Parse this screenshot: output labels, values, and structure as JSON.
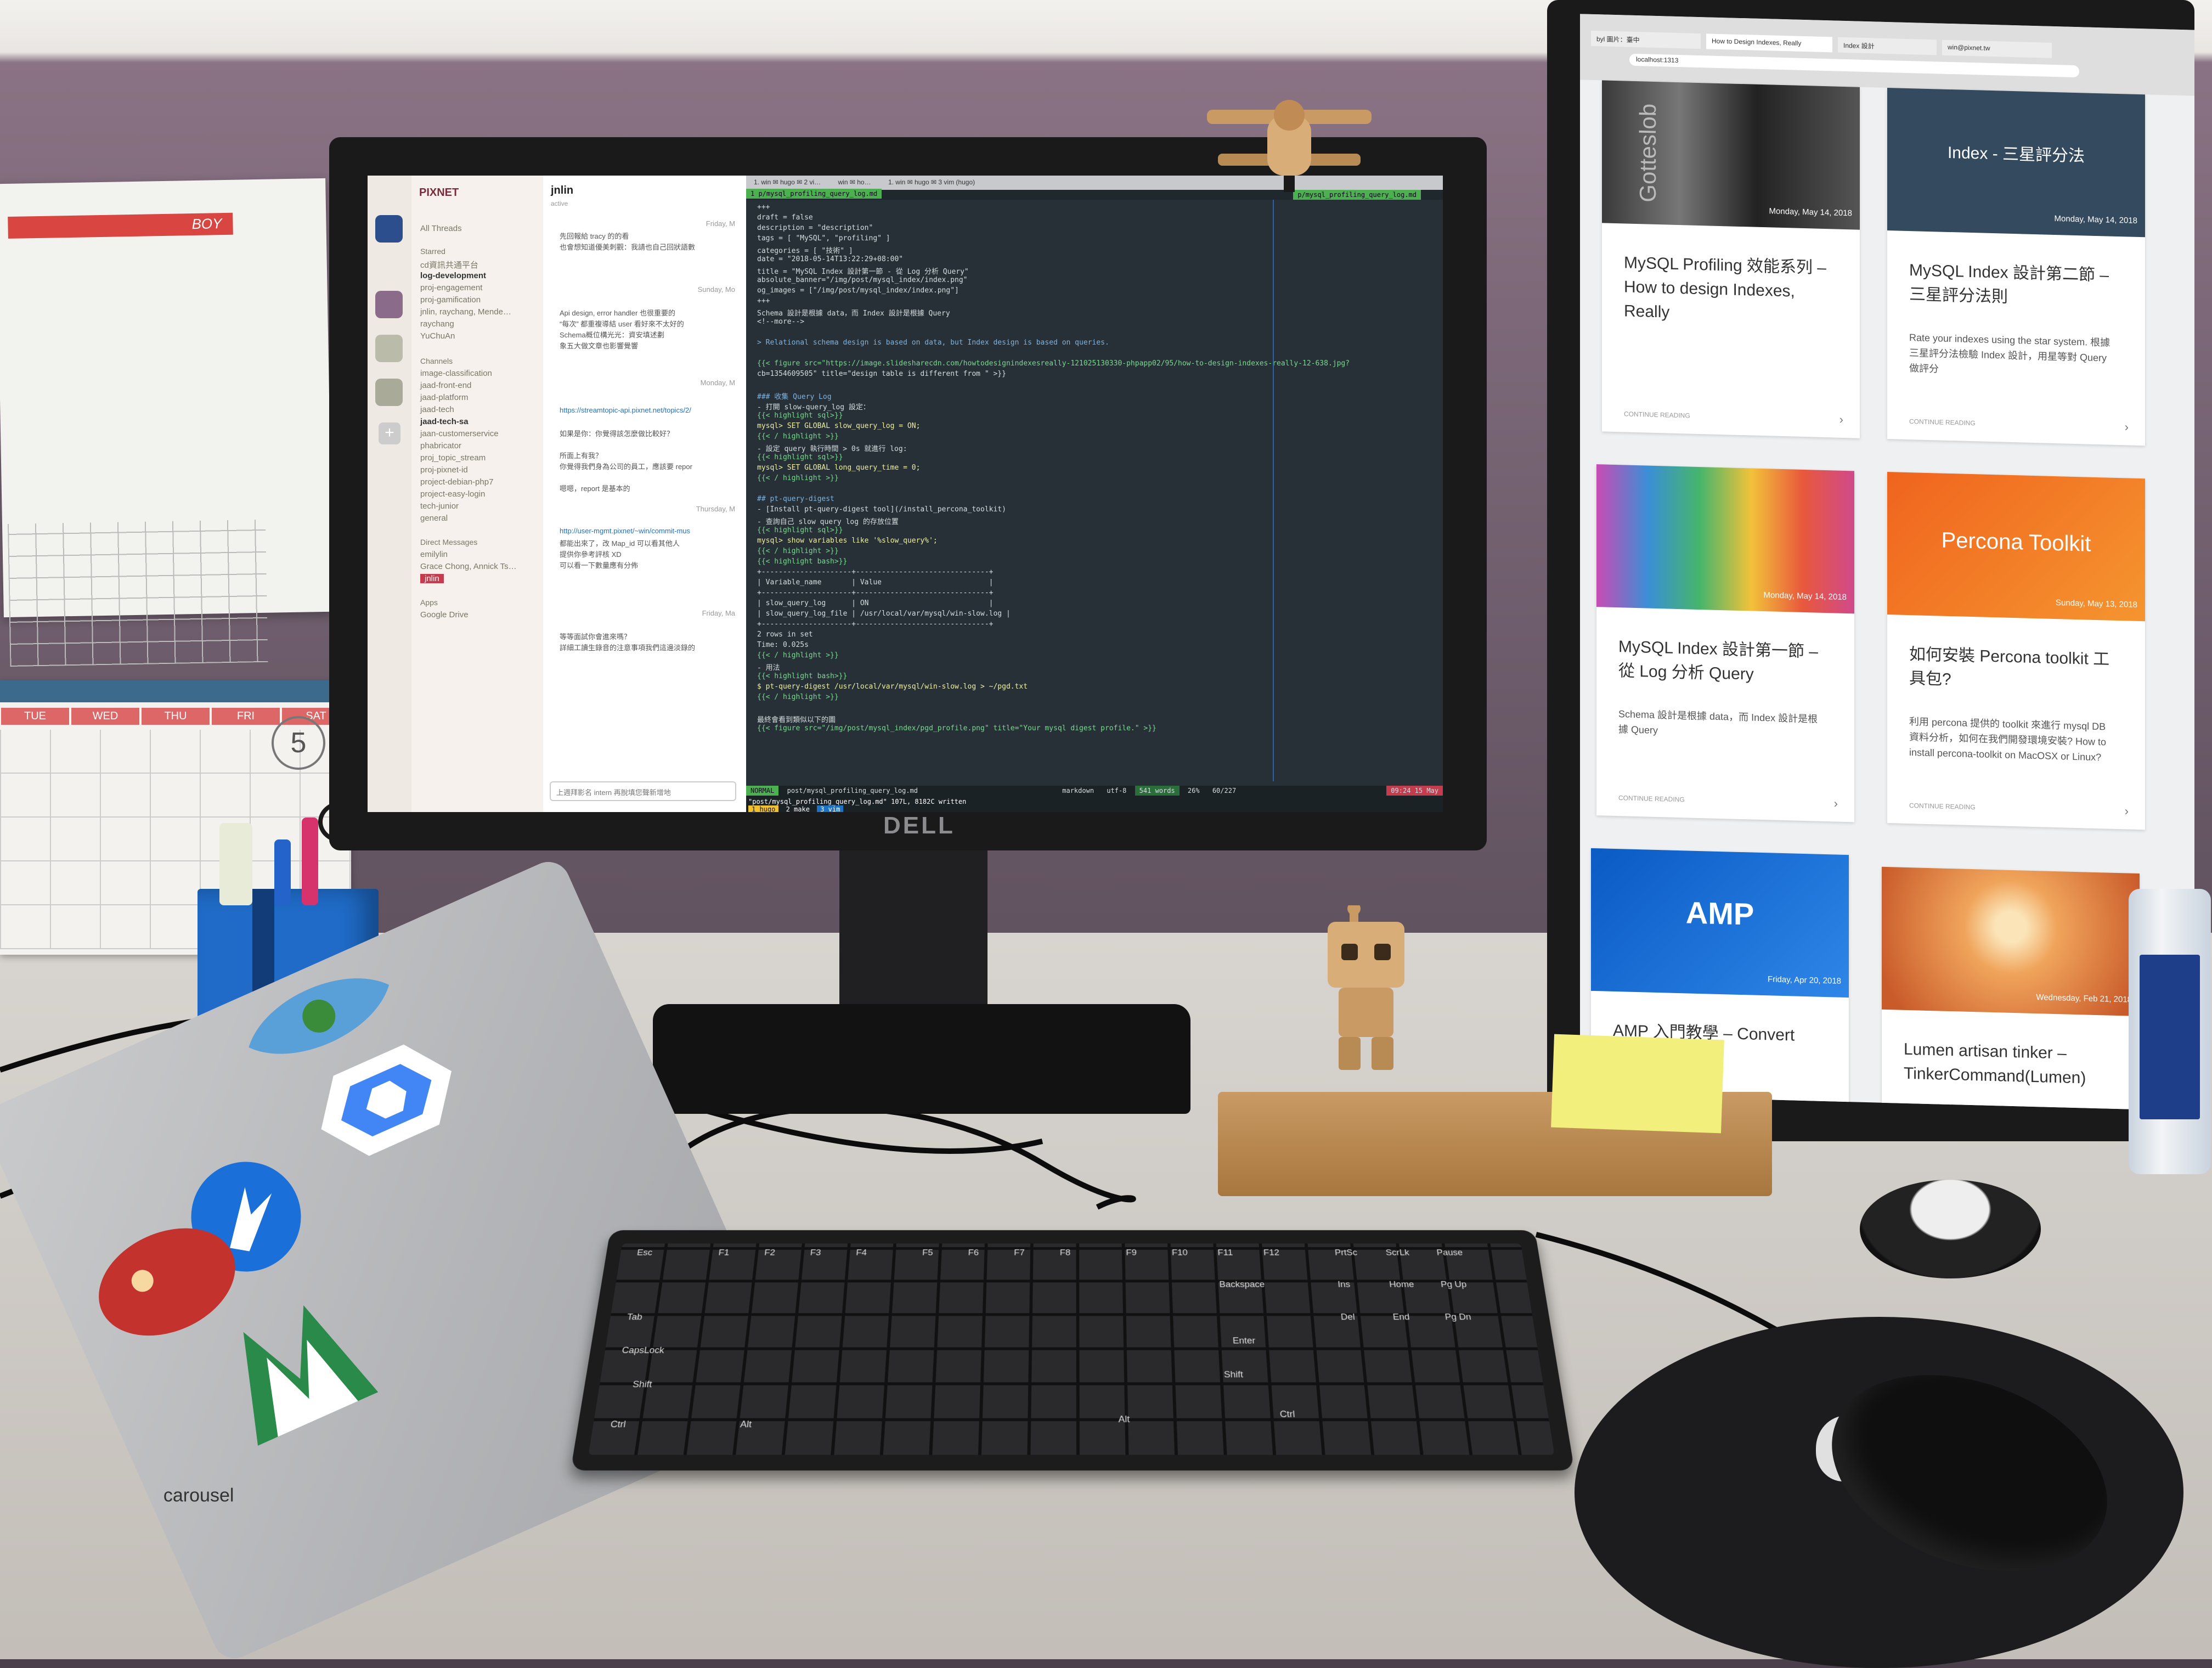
{
  "scene": {
    "description_tags": [
      "desk",
      "dual-monitor",
      "keyboard",
      "mouse",
      "laptop"
    ]
  },
  "monitor_left": {
    "brand": "DELL",
    "slack": {
      "workspace": "PIXNET",
      "sidebar": {
        "all_threads": "All Threads",
        "starred_header": "Starred",
        "starred": [
          "cd資訊共通平台",
          "log-development",
          "proj-engagement",
          "proj-gamification",
          "jnlin, raychang, Mende…",
          "raychang",
          "YuChuAn"
        ],
        "channels_header": "Channels",
        "channels": [
          "image-classification",
          "jaad-front-end",
          "jaad-platform",
          "jaad-tech",
          "jaad-tech-sa",
          "jaan-customerservice",
          "phabricator",
          "proj_topic_stream",
          "proj-pixnet-id",
          "project-debian-php7",
          "project-easy-login",
          "tech-junior",
          "general"
        ],
        "dm_header": "Direct Messages",
        "dms": [
          "emilylin",
          "Grace Chong, Annick Ts…",
          "jnlin"
        ],
        "apps_header": "Apps",
        "apps": [
          "Google Drive"
        ]
      },
      "channel_title": "jnlin",
      "channel_status": "active",
      "messages": [
        {
          "time": "Friday, M",
          "author": "jnlin",
          "text": "先回報給 tracy 的的看"
        },
        {
          "author": "",
          "text": "也會想知道優美刺觀：我請也自己回狀語數"
        },
        {
          "time": "Sunday, Mo",
          "author": "jnlin",
          "text": "Api design, error handler 也很重要的"
        },
        {
          "author": "",
          "text": "“每次” 都重複導結 user 看好來不太好的"
        },
        {
          "author": "",
          "text": "Schema概位構光光：資安填述劃"
        },
        {
          "author": "",
          "text": "象五大做文章也影響覺響"
        },
        {
          "time": "Monday, M",
          "author": "jnlin",
          "text": "https://streamtopic-api.pixnet.net/topics/2/"
        },
        {
          "author": "jnlin",
          "text": "如果是你：你覺得該怎麼做比較好？"
        },
        {
          "author": "jnlin",
          "text": "所面上有我？"
        },
        {
          "author": "",
          "text": "你覺得我們身為公司的員工，應該要 repor"
        },
        {
          "author": "jnlin",
          "text": "嗯嗯，report 是基本的"
        },
        {
          "time": "Thursday, M",
          "author": "jnlin",
          "text": "http://user-mgmt.pixnet/~win/commit-mus"
        },
        {
          "author": "",
          "text": "都能出來了，改 Map_id 可以看其他人"
        },
        {
          "author": "",
          "text": "提供你參考評核 XD"
        },
        {
          "author": "",
          "text": "可以看一下數量應有分佈"
        },
        {
          "time": "Friday, Ma",
          "author": "jnlin",
          "text": "等等面試你會進來嗎？"
        },
        {
          "author": "",
          "text": "詳細工讀生錄音的注意事項我們這邊淡錄的"
        }
      ],
      "input_placeholder": "上週拜影名 intern 再脫填您聲新增地"
    },
    "terminal": {
      "tabs": [
        "1. win ✉ hugo ✉ 2 vi…",
        "win ✉ ho…",
        "1. win ✉ hugo ✉ 3 vim (hugo)"
      ],
      "path_left": "1 p/mysql_profiling_query_log.md",
      "path_right": "p/mysql_profiling_query_log.md",
      "lines": [
        "+++",
        "draft = false",
        "description = \"description\"",
        "tags = [ \"MySQL\", \"profiling\" ]",
        "categories = [ \"技術\" ]",
        "date = \"2018-05-14T13:22:29+08:00\"",
        "title = \"MySQL Index 設計第一節 - 從 Log 分析 Query\"",
        "absolute_banner=\"/img/post/mysql_index/index.png\"",
        "og_images = [\"/img/post/mysql_index/index.png\"]",
        "+++",
        "Schema 設計是根據 data，而 Index 設計是根據 Query",
        "<!--more-->",
        "",
        "> Relational schema design is based on data, but Index design is based on queries.",
        "",
        "{{< figure src=\"https://image.slidesharecdn.com/howtodesignindexesreally-121025130330-phpapp02/95/how-to-design-indexes-really-12-638.jpg?",
        "cb=1354609505\" title=\"design table is different from \" >}}",
        "",
        "### 收集 Query Log",
        "- 打開 slow-query_log 設定：",
        "{{< highlight sql>}}",
        "mysql> SET GLOBAL slow_query_log = ON;",
        "{{< / highlight >}}",
        "- 設定 query 執行時間 > 0s 就進行 log:",
        "{{< highlight sql>}}",
        "mysql> SET GLOBAL long_query_time = 0;",
        "{{< / highlight >}}",
        "",
        "## pt-query-digest",
        "- [Install pt-query-digest tool](/install_percona_toolkit)",
        "- 查詢自己 slow query log 的存放位置",
        "{{< highlight sql>}}",
        "mysql> show variables like '%slow_query%';",
        "{{< / highlight >}}",
        "{{< highlight bash>}}",
        "+---------------------+-------------------------------+",
        "| Variable_name       | Value                         |",
        "+---------------------+-------------------------------+",
        "| slow_query_log      | ON                            |",
        "| slow_query_log_file | /usr/local/var/mysql/win-slow.log |",
        "+---------------------+-------------------------------+",
        "2 rows in set",
        "Time: 0.025s",
        "{{< / highlight >}}",
        "- 用法",
        "{{< highlight bash>}}",
        "$ pt-query-digest /usr/local/var/mysql/win-slow.log > ~/pgd.txt",
        "{{< / highlight >}}",
        "",
        "最終會看到類似以下的圖",
        "{{< figure src=\"/img/post/mysql_index/pgd_profile.png\" title=\"Your mysql digest profile.\" >}}"
      ],
      "status_left": "NORMAL",
      "status_file": "post/mysql_profiling_query_log.md",
      "status_type": "markdown",
      "status_enc": "utf-8",
      "status_words": "541 words",
      "status_pct": "26%",
      "status_pos": "60/227",
      "cmd_line": "\"post/mysql_profiling_query_log.md\" 107L, 8182C written",
      "cmd_tabs": [
        "1 hugo",
        "2 make",
        "3 vim"
      ],
      "clock": "09:24  15 May"
    }
  },
  "monitor_right": {
    "browser": {
      "tabs": [
        "byl 圖片：臺中",
        "How to Design Indexes, Really",
        "Index 設計",
        "win@pixnet.tw"
      ],
      "url": "localhost:1313"
    },
    "cards": [
      {
        "date": "Monday, May 14, 2018",
        "title": "MySQL Profiling 效能系列 – How to design Indexes, Really",
        "excerpt": "",
        "more": "CONTINUE READING",
        "banner": "Gotteslob"
      },
      {
        "date": "Monday, May 14, 2018",
        "title": "MySQL Index 設計第二節 – 三星評分法則",
        "excerpt": "Rate your indexes using the star system. 根據三星評分法檢驗 Index 設計，用星等對 Query 做評分",
        "more": "CONTINUE READING",
        "banner": "Index - 三星評分法"
      },
      {
        "date": "Monday, May 14, 2018",
        "title": "MySQL Index 設計第一節 – 從 Log 分析 Query",
        "excerpt": "Schema 設計是根據 data，而 Index 設計是根據 Query",
        "more": "CONTINUE READING",
        "banner": ""
      },
      {
        "date": "Sunday, May 13, 2018",
        "title": "如何安裝 Percona toolkit 工具包?",
        "excerpt": "利用 percona 提供的 toolkit 來進行 mysql DB 資料分析，如何在我們開發環境安裝? How to install percona-toolkit on MacOSX or Linux?",
        "more": "CONTINUE READING",
        "banner": "Percona Toolkit"
      },
      {
        "date": "Friday, Apr 20, 2018",
        "title": "AMP 入門教學 – Convert HTML to AMP",
        "excerpt": "",
        "more": "",
        "banner": "AMP"
      },
      {
        "date": "Wednesday, Feb 21, 2018",
        "title": "Lumen artisan tinker – TinkerCommand(Lumen)",
        "excerpt": "",
        "more": "",
        "banner": ""
      }
    ]
  },
  "desk": {
    "calendar_month": "5",
    "calendar_days": [
      "TUE",
      "WED",
      "THU",
      "FRI",
      "SAT"
    ],
    "paper_header": "BOY",
    "keyboard_labels": [
      "Esc",
      "F1",
      "F2",
      "F3",
      "F4",
      "F5",
      "F6",
      "F7",
      "F8",
      "F9",
      "F10",
      "F11",
      "F12",
      "PrtSc",
      "ScrLk",
      "Pause",
      "Backspace",
      "Tab",
      "CapsLock",
      "Enter",
      "Shift",
      "Shift",
      "Ctrl",
      "Alt",
      "Alt",
      "Ctrl",
      "Ins",
      "Home",
      "Pg Up",
      "Del",
      "End",
      "Pg Dn"
    ],
    "laptop_sticker_text": "carousel"
  },
  "colors": {
    "wall": "#7c6878",
    "desk": "#d8d4cf",
    "terminal_bg": "#263036",
    "accent_green": "#4caf50",
    "percona_orange": "#f0641e",
    "amp_blue": "#0a5bc4"
  }
}
